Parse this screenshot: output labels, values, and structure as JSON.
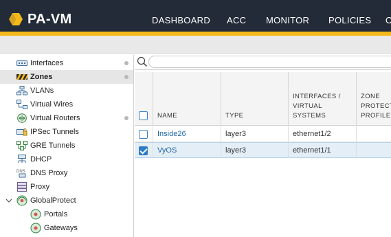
{
  "app": {
    "logo_text": "PA-VM",
    "nav": [
      "DASHBOARD",
      "ACC",
      "MONITOR",
      "POLICIES",
      "O"
    ]
  },
  "sidebar": {
    "items": [
      {
        "label": "Interfaces",
        "icon": "interfaces-icon"
      },
      {
        "label": "Zones",
        "icon": "zones-icon"
      },
      {
        "label": "VLANs",
        "icon": "vlans-icon"
      },
      {
        "label": "Virtual Wires",
        "icon": "virtual-wires-icon"
      },
      {
        "label": "Virtual Routers",
        "icon": "virtual-routers-icon"
      },
      {
        "label": "IPSec Tunnels",
        "icon": "ipsec-tunnels-icon"
      },
      {
        "label": "GRE Tunnels",
        "icon": "gre-tunnels-icon"
      },
      {
        "label": "DHCP",
        "icon": "dhcp-icon"
      },
      {
        "label": "DNS Proxy",
        "icon": "dns-proxy-icon"
      },
      {
        "label": "Proxy",
        "icon": "proxy-icon"
      },
      {
        "label": "GlobalProtect",
        "icon": "globalprotect-icon"
      },
      {
        "label": "Portals",
        "icon": "portals-icon"
      },
      {
        "label": "Gateways",
        "icon": "gateways-icon"
      }
    ],
    "active": "Zones",
    "dns_icon_text": "DNS"
  },
  "search": {
    "value": "",
    "placeholder": ""
  },
  "table": {
    "headers": [
      "NAME",
      "TYPE",
      "INTERFACES / VIRTUAL SYSTEMS",
      "ZONE PROTECTION PROFILE"
    ],
    "header_display": [
      "NAME",
      "TYPE",
      "INTERFACES /\nVIRTUAL\nSYSTEMS",
      "ZONE\nPROTECT\nPROFILE"
    ],
    "rows": [
      {
        "name": "Inside26",
        "type": "layer3",
        "interfaces": "ethernet1/2",
        "zone_profile": "",
        "checked": false
      },
      {
        "name": "VyOS",
        "type": "layer3",
        "interfaces": "ethernet1/1",
        "zone_profile": "",
        "checked": true
      }
    ]
  },
  "colors": {
    "topbar": "#232b38",
    "accent": "#f5b91b",
    "link": "#2166a7",
    "selected_row": "#e3eef7"
  }
}
